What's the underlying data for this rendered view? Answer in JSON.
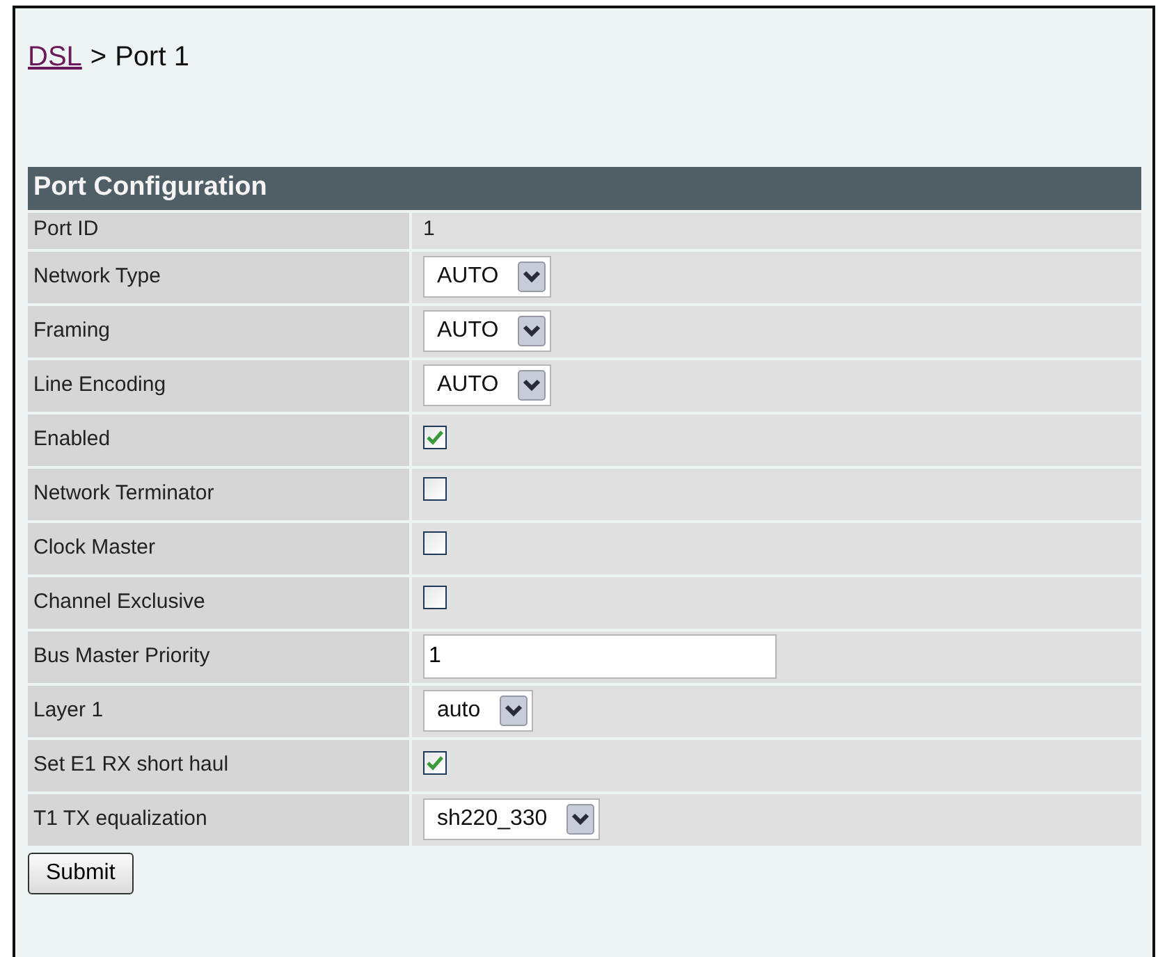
{
  "breadcrumb": {
    "link": "DSL",
    "separator": ">",
    "current": "Port 1"
  },
  "section": {
    "title": "Port Configuration"
  },
  "rows": [
    {
      "label": "Port ID",
      "kind": "text",
      "value": "1"
    },
    {
      "label": "Network Type",
      "kind": "select",
      "value": "AUTO"
    },
    {
      "label": "Framing",
      "kind": "select",
      "value": "AUTO"
    },
    {
      "label": "Line Encoding",
      "kind": "select",
      "value": "AUTO"
    },
    {
      "label": "Enabled",
      "kind": "checkbox",
      "checked": true
    },
    {
      "label": "Network Terminator",
      "kind": "checkbox",
      "checked": false
    },
    {
      "label": "Clock Master",
      "kind": "checkbox",
      "checked": false
    },
    {
      "label": "Channel Exclusive",
      "kind": "checkbox",
      "checked": false
    },
    {
      "label": "Bus Master Priority",
      "kind": "input",
      "value": "1"
    },
    {
      "label": "Layer 1",
      "kind": "select",
      "value": "auto"
    },
    {
      "label": "Set E1 RX short haul",
      "kind": "checkbox",
      "checked": true
    },
    {
      "label": "T1 TX equalization",
      "kind": "select",
      "value": "sh220_330"
    }
  ],
  "buttons": [
    "Submit"
  ]
}
